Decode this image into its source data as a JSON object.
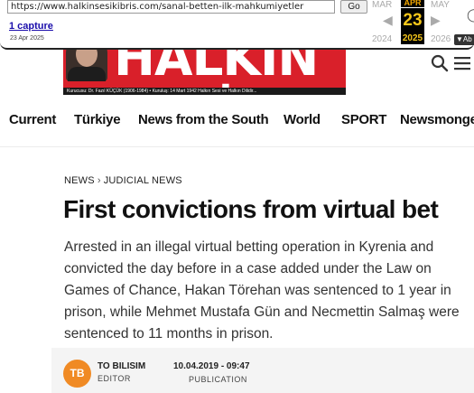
{
  "wayback": {
    "url": "https://www.halkinsesikibris.com/sanal-betten-ilk-mahkumiyetler",
    "go_label": "Go",
    "captures_label": "1 capture",
    "capture_date": "23 Apr 2025",
    "prev_month": "MAR",
    "current_month": "APR",
    "next_month": "MAY",
    "current_day": "23",
    "prev_year": "2024",
    "current_year": "2025",
    "next_year": "2026",
    "about_label": "Ab"
  },
  "header": {
    "brand": "HALKIN SESİ",
    "tagline": "Kurucusu: Dr. Fazıl KÜÇÜK (1906-1984) • Kuruluş: 14 Mart 1942          Halkın Sesi ve Halkın Dilidir..."
  },
  "nav": {
    "items": [
      "Current",
      "Türkiye",
      "News from the South",
      "World",
      "SPORT",
      "Newsmonger"
    ]
  },
  "article": {
    "breadcrumb_section": "NEWS",
    "breadcrumb_sep": "›",
    "breadcrumb_category": "JUDICIAL NEWS",
    "title": "First convictions from virtual bet",
    "lead": "Arrested in an illegal virtual betting operation in Kyrenia and convicted the day before in a case added under the Law on Games of Chance, Hakan Törehan was sentenced to 1 year in prison, while Mehmet Mustafa Gün and Necmettin Salmaş were sentenced to 11 months in prison.",
    "author_initials": "TB",
    "author_name": "TO BILISIM",
    "author_role": "EDITOR",
    "publish_date": "10.04.2019 - 09:47",
    "publish_label": "PUBLICATION"
  },
  "colors": {
    "brand_red": "#d9202a",
    "avatar_orange": "#f08a24",
    "wayback_highlight": "#f5c61a"
  }
}
